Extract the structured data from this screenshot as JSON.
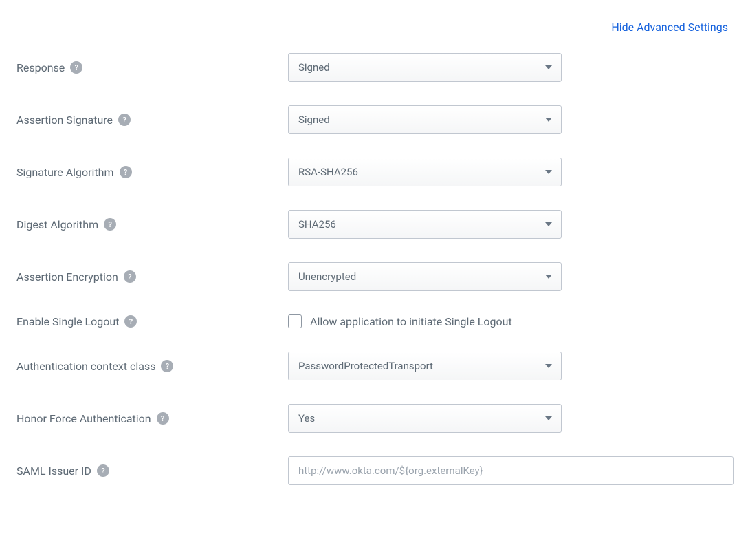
{
  "advanced_link": "Hide Advanced Settings",
  "fields": {
    "response": {
      "label": "Response",
      "value": "Signed"
    },
    "assertion_signature": {
      "label": "Assertion Signature",
      "value": "Signed"
    },
    "signature_algorithm": {
      "label": "Signature Algorithm",
      "value": "RSA-SHA256"
    },
    "digest_algorithm": {
      "label": "Digest Algorithm",
      "value": "SHA256"
    },
    "assertion_encryption": {
      "label": "Assertion Encryption",
      "value": "Unencrypted"
    },
    "enable_single_logout": {
      "label": "Enable Single Logout",
      "checkbox_label": "Allow application to initiate Single Logout"
    },
    "authentication_context_class": {
      "label": "Authentication context class",
      "value": "PasswordProtectedTransport"
    },
    "honor_force_authentication": {
      "label": "Honor Force Authentication",
      "value": "Yes"
    },
    "saml_issuer_id": {
      "label": "SAML Issuer ID",
      "placeholder": "http://www.okta.com/${org.externalKey}"
    }
  },
  "help_glyph": "?"
}
